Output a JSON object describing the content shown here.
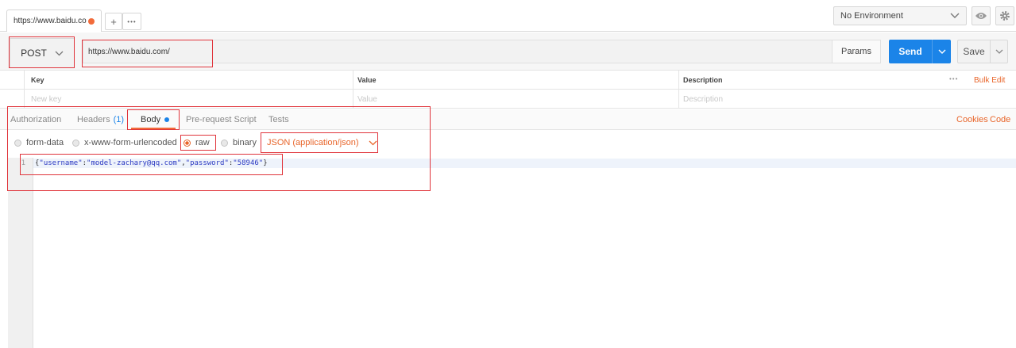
{
  "tabbar": {
    "tab_title": "https://www.baidu.co",
    "add_label": "+",
    "more_label": "•••",
    "environment": "No Environment"
  },
  "request": {
    "method": "POST",
    "url": "https://www.baidu.com/",
    "params_label": "Params",
    "send_label": "Send",
    "save_label": "Save"
  },
  "params_table": {
    "headers": {
      "key": "Key",
      "value": "Value",
      "description": "Description"
    },
    "more_label": "•••",
    "bulk_edit_label": "Bulk Edit",
    "placeholders": {
      "key": "New key",
      "value": "Value",
      "description": "Description"
    }
  },
  "tabs": {
    "authorization": "Authorization",
    "headers": "Headers",
    "headers_count": "(1)",
    "body": "Body",
    "pre_request": "Pre-request Script",
    "tests": "Tests",
    "cookies": "Cookies",
    "code": "Code"
  },
  "body_options": {
    "form_data": "form-data",
    "urlencoded": "x-www-form-urlencoded",
    "raw": "raw",
    "binary": "binary",
    "content_type": "JSON (application/json)"
  },
  "editor": {
    "line_number": "1",
    "brace_open": "{",
    "key1": "\"username\"",
    "colon": ":",
    "val1": "\"model-zachary@qq.com\"",
    "comma": ",",
    "key2": "\"password\"",
    "val2": "\"58946\"",
    "brace_close": "}"
  },
  "colors": {
    "accent_orange": "#e8652a",
    "send_blue": "#1b84e8",
    "annotation_red": "#e0343b"
  }
}
